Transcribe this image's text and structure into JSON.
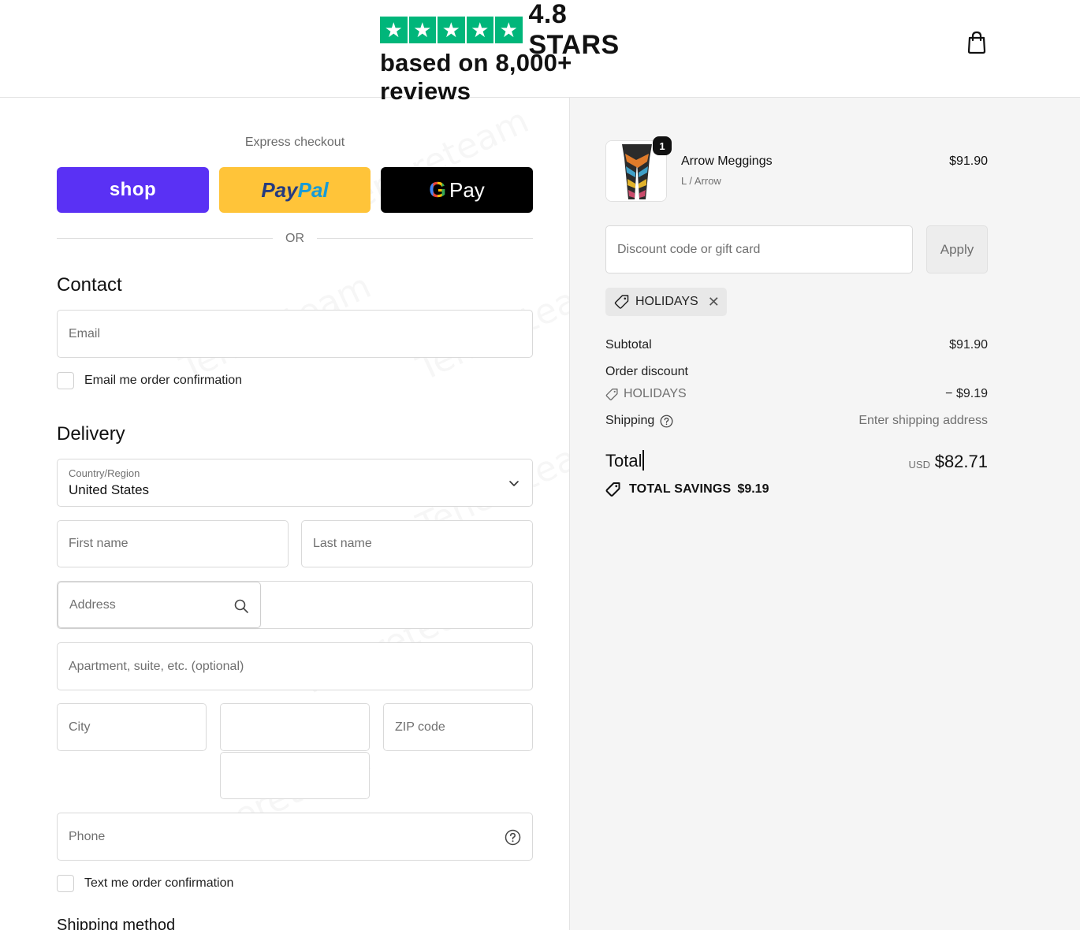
{
  "header": {
    "rating_value": "4.8 STARS",
    "rating_sub": "based on 8,000+ reviews",
    "star_glyph": "★",
    "star_count": 5,
    "star_color": "#00b67a",
    "cart_icon": "shopping-bag-icon"
  },
  "express": {
    "title": "Express checkout",
    "shop_label": "shop",
    "paypal_label_a": "Pay",
    "paypal_label_b": "Pal",
    "gpay_g": "G",
    "gpay_label": "Pay",
    "or_text": "OR",
    "colors": {
      "shop": "#5a31f4",
      "paypal": "#ffc439",
      "gpay": "#000000"
    }
  },
  "contact": {
    "title": "Contact",
    "email_placeholder": "Email",
    "email_optin_label": "Email me order confirmation",
    "email_optin_checked": false
  },
  "delivery": {
    "title": "Delivery",
    "country_label": "Country/Region",
    "country_value": "United States",
    "first_name_placeholder": "First name",
    "last_name_placeholder": "Last name",
    "address_placeholder": "Address",
    "apartment_placeholder": "Apartment, suite, etc. (optional)",
    "city_placeholder": "City",
    "state_value": "",
    "zip_placeholder": "ZIP code",
    "phone_placeholder": "Phone",
    "sms_optin_label": "Text me order confirmation",
    "sms_optin_checked": false,
    "shipping_method_title": "Shipping method"
  },
  "order": {
    "item": {
      "name": "Arrow Meggings",
      "variant": "L / Arrow",
      "price": "$91.90",
      "quantity": "1"
    },
    "discount_placeholder": "Discount code or gift card",
    "apply_label": "Apply",
    "applied_code": "HOLIDAYS",
    "subtotal_label": "Subtotal",
    "subtotal_value": "$91.90",
    "order_discount_label": "Order discount",
    "discount_code": "HOLIDAYS",
    "discount_value": "− $9.19",
    "shipping_label": "Shipping",
    "shipping_value": "Enter shipping address",
    "total_label": "Total",
    "total_currency": "USD",
    "total_value": "$82.71",
    "savings_label": "TOTAL SAVINGS",
    "savings_value": "$9.19"
  },
  "watermark": "Tenereteam"
}
